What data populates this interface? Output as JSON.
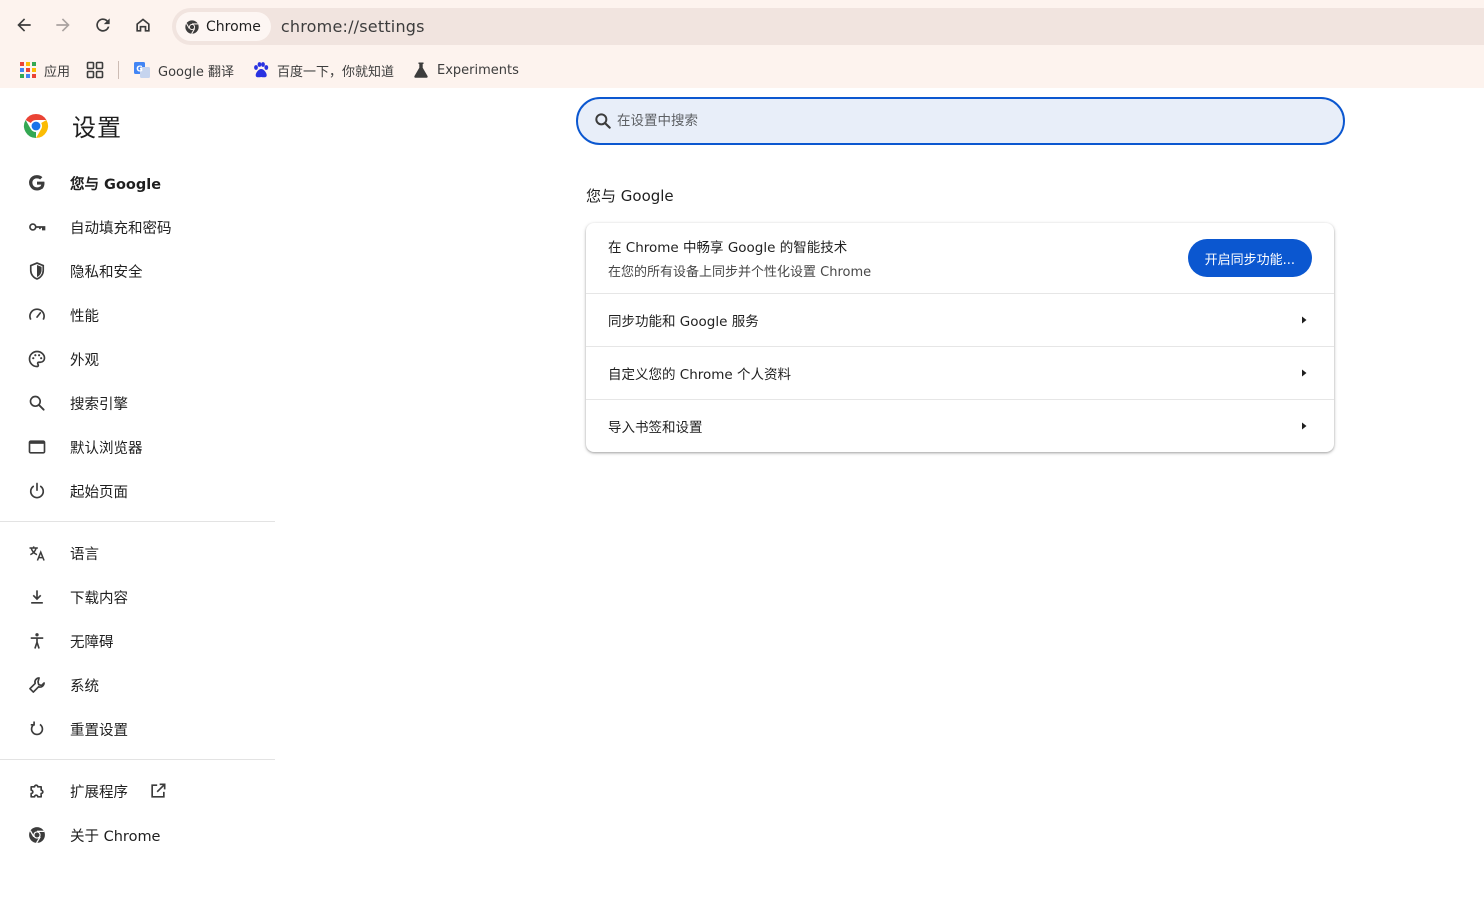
{
  "browser": {
    "chip_label": "Chrome",
    "url": "chrome://settings"
  },
  "bookmarks": {
    "apps_label": "应用",
    "items": [
      {
        "label": "Google 翻译"
      },
      {
        "label": "百度一下，你就知道"
      },
      {
        "label": "Experiments"
      }
    ]
  },
  "header": {
    "title": "设置"
  },
  "search": {
    "placeholder": "在设置中搜索",
    "value": ""
  },
  "sidebar": {
    "items": [
      {
        "label": "您与 Google"
      },
      {
        "label": "自动填充和密码"
      },
      {
        "label": "隐私和安全"
      },
      {
        "label": "性能"
      },
      {
        "label": "外观"
      },
      {
        "label": "搜索引擎"
      },
      {
        "label": "默认浏览器"
      },
      {
        "label": "起始页面"
      },
      {
        "label": "语言"
      },
      {
        "label": "下载内容"
      },
      {
        "label": "无障碍"
      },
      {
        "label": "系统"
      },
      {
        "label": "重置设置"
      },
      {
        "label": "扩展程序"
      },
      {
        "label": "关于 Chrome"
      }
    ]
  },
  "main": {
    "section_title": "您与 Google",
    "promo": {
      "line1": "在 Chrome 中畅享 Google 的智能技术",
      "line2": "在您的所有设备上同步并个性化设置 Chrome",
      "button": "开启同步功能..."
    },
    "rows": [
      {
        "label": "同步功能和 Google 服务"
      },
      {
        "label": "自定义您的 Chrome 个人资料"
      },
      {
        "label": "导入书签和设置"
      }
    ]
  },
  "colors": {
    "accent": "#0b57d0",
    "toolbar_bg": "#fdf3ee",
    "search_bg": "#e8eef9"
  }
}
